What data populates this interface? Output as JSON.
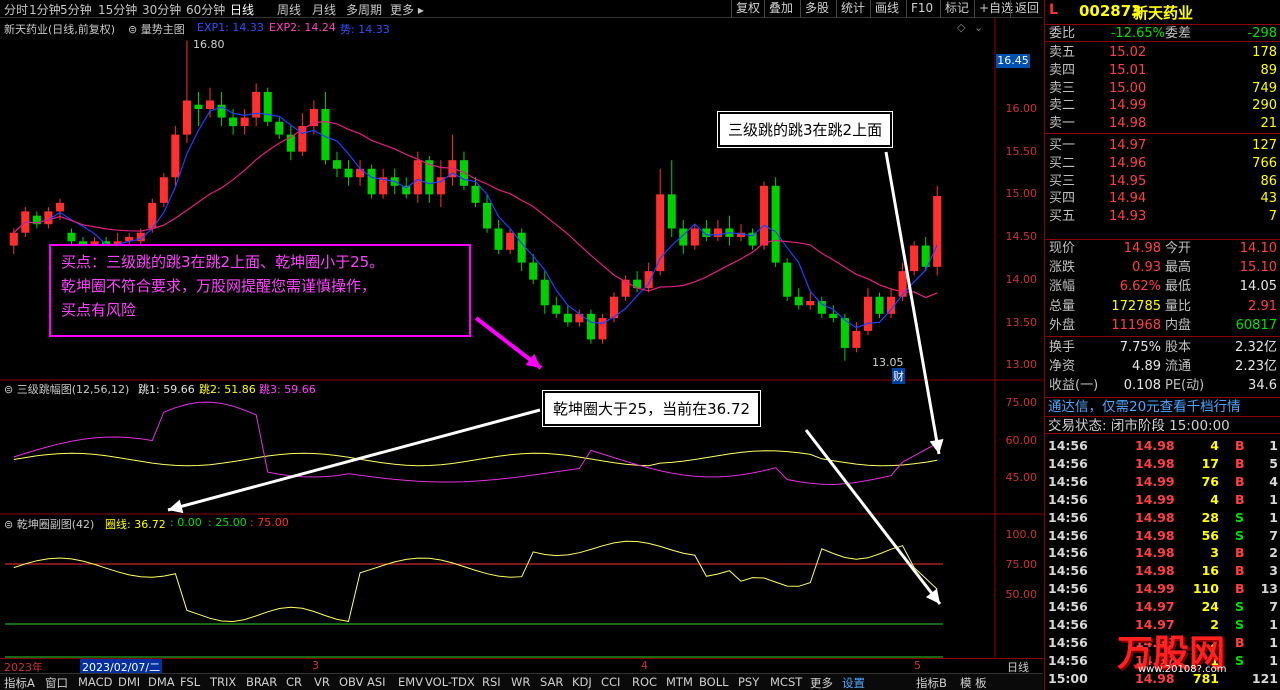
{
  "toolbar": {
    "periods": [
      "分时",
      "1分钟",
      "5分钟",
      "15分钟",
      "30分钟",
      "60分钟",
      "日线",
      "周线",
      "月线",
      "多周期",
      "更多"
    ],
    "active_period": "日线",
    "buttons": [
      "复权",
      "叠加",
      "多股",
      "统计",
      "画线",
      "F10",
      "标记",
      "+自选",
      "返回"
    ]
  },
  "main_panel": {
    "title": "新天药业(日线,前复权)",
    "indicator": "量势主图",
    "exp1": "EXP1: 14.33",
    "exp2": "EXP2: 14.24",
    "shi": "势: 14.33",
    "high_label": "16.80",
    "low_label": "13.05",
    "cai_label": "财",
    "price_tag": "16.45",
    "y_ticks": [
      "16.00",
      "15.50",
      "15.00",
      "14.50",
      "14.00",
      "13.50",
      "13.00"
    ]
  },
  "sub1": {
    "title": "三级跳幅图(12,56,12)",
    "tiao1": "跳1: 59.66",
    "tiao2": "跳2: 51.86",
    "tiao3": "跳3: 59.66",
    "y_ticks": [
      "75.00",
      "60.00",
      "45.00"
    ]
  },
  "sub2": {
    "title": "乾坤圈副图(42)",
    "quan": "圈线: 36.72",
    "l1": ": 0.00",
    "l2": ": 25.00",
    "l3": ": 75.00",
    "y_ticks": [
      "100.0",
      "75.00",
      "50.00"
    ]
  },
  "annotations": {
    "buy_line1": "买点：三级跳的跳3在跳2上面、乾坤圈小于25。",
    "buy_line2": "乾坤圈不符合要求，万股网提醒您需谨慎操作，",
    "buy_line3": "买点有风险",
    "box1": "三级跳的跳3在跳2上面",
    "box2": "乾坤圈大于25，当前在36.72"
  },
  "datebar": {
    "year": "2023年",
    "date": "2023/02/07/二",
    "m3": "3",
    "m4": "4",
    "m5": "5",
    "period": "日线"
  },
  "tabs": [
    "指标A",
    "窗口",
    "MACD",
    "DMI",
    "DMA",
    "FSL",
    "TRIX",
    "BRAR",
    "CR",
    "VR",
    "OBV",
    "ASI",
    "EMV",
    "VOL-TDX",
    "RSI",
    "WR",
    "SAR",
    "KDJ",
    "CCI",
    "ROC",
    "MTM",
    "BOLL",
    "PSY",
    "MCST",
    "更多",
    "设置",
    "指标B",
    "模 板"
  ],
  "quote": {
    "flag": "L",
    "code": "002873",
    "name": "新天药业",
    "weibi_label": "委比",
    "weibi": "-12.65%",
    "weicha_label": "委差",
    "weicha": "-298",
    "asks": [
      {
        "label": "卖五",
        "price": "15.02",
        "vol": "178"
      },
      {
        "label": "卖四",
        "price": "15.01",
        "vol": "89"
      },
      {
        "label": "卖三",
        "price": "15.00",
        "vol": "749"
      },
      {
        "label": "卖二",
        "price": "14.99",
        "vol": "290"
      },
      {
        "label": "卖一",
        "price": "14.98",
        "vol": "21"
      }
    ],
    "bids": [
      {
        "label": "买一",
        "price": "14.97",
        "vol": "127"
      },
      {
        "label": "买二",
        "price": "14.96",
        "vol": "766"
      },
      {
        "label": "买三",
        "price": "14.95",
        "vol": "86"
      },
      {
        "label": "买四",
        "price": "14.94",
        "vol": "43"
      },
      {
        "label": "买五",
        "price": "14.93",
        "vol": "7"
      }
    ],
    "stats": [
      {
        "l1": "现价",
        "v1": "14.98",
        "c1": "red",
        "l2": "今开",
        "v2": "14.10",
        "c2": "red"
      },
      {
        "l1": "涨跌",
        "v1": "0.93",
        "c1": "red",
        "l2": "最高",
        "v2": "15.10",
        "c2": "red"
      },
      {
        "l1": "涨幅",
        "v1": "6.62%",
        "c1": "red",
        "l2": "最低",
        "v2": "14.05",
        "c2": "white"
      },
      {
        "l1": "总量",
        "v1": "172785",
        "c1": "yellow",
        "l2": "量比",
        "v2": "2.91",
        "c2": "red"
      },
      {
        "l1": "外盘",
        "v1": "111968",
        "c1": "red",
        "l2": "内盘",
        "v2": "60817",
        "c2": "green"
      },
      {
        "l1": "换手",
        "v1": "7.75%",
        "c1": "white",
        "l2": "股本",
        "v2": "2.32亿",
        "c2": "white"
      },
      {
        "l1": "净资",
        "v1": "4.89",
        "c1": "white",
        "l2": "流通",
        "v2": "2.23亿",
        "c2": "white"
      },
      {
        "l1": "收益(一)",
        "v1": "0.108",
        "c1": "white",
        "l2": "PE(动)",
        "v2": "34.6",
        "c2": "white"
      }
    ],
    "banner": "通达信，仅需20元查看千档行情",
    "status": "交易状态: 闭市阶段 15:00:00",
    "ticks": [
      {
        "t": "14:56",
        "p": "14.98",
        "v": "4",
        "bs": "B",
        "n": "1"
      },
      {
        "t": "14:56",
        "p": "14.98",
        "v": "17",
        "bs": "B",
        "n": "5"
      },
      {
        "t": "14:56",
        "p": "14.99",
        "v": "76",
        "bs": "B",
        "n": "4"
      },
      {
        "t": "14:56",
        "p": "14.99",
        "v": "4",
        "bs": "B",
        "n": "1"
      },
      {
        "t": "14:56",
        "p": "14.98",
        "v": "28",
        "bs": "S",
        "n": "1"
      },
      {
        "t": "14:56",
        "p": "14.98",
        "v": "56",
        "bs": "S",
        "n": "7"
      },
      {
        "t": "14:56",
        "p": "14.98",
        "v": "3",
        "bs": "B",
        "n": "2"
      },
      {
        "t": "14:56",
        "p": "14.98",
        "v": "16",
        "bs": "B",
        "n": "3"
      },
      {
        "t": "14:56",
        "p": "14.99",
        "v": "110",
        "bs": "B",
        "n": "13"
      },
      {
        "t": "14:56",
        "p": "14.97",
        "v": "24",
        "bs": "S",
        "n": "7"
      },
      {
        "t": "14:56",
        "p": "14.97",
        "v": "2",
        "bs": "S",
        "n": "1"
      },
      {
        "t": "14:56",
        "p": "14.98",
        "v": "2",
        "bs": "B",
        "n": "1"
      },
      {
        "t": "14:56",
        "p": "14.97",
        "v": "1",
        "bs": "S",
        "n": "1"
      },
      {
        "t": "15:00",
        "p": "14.98",
        "v": "781",
        "bs": "",
        "n": "121"
      }
    ],
    "watermark": "万股网",
    "watermark_url": "www.20108?.com"
  }
}
